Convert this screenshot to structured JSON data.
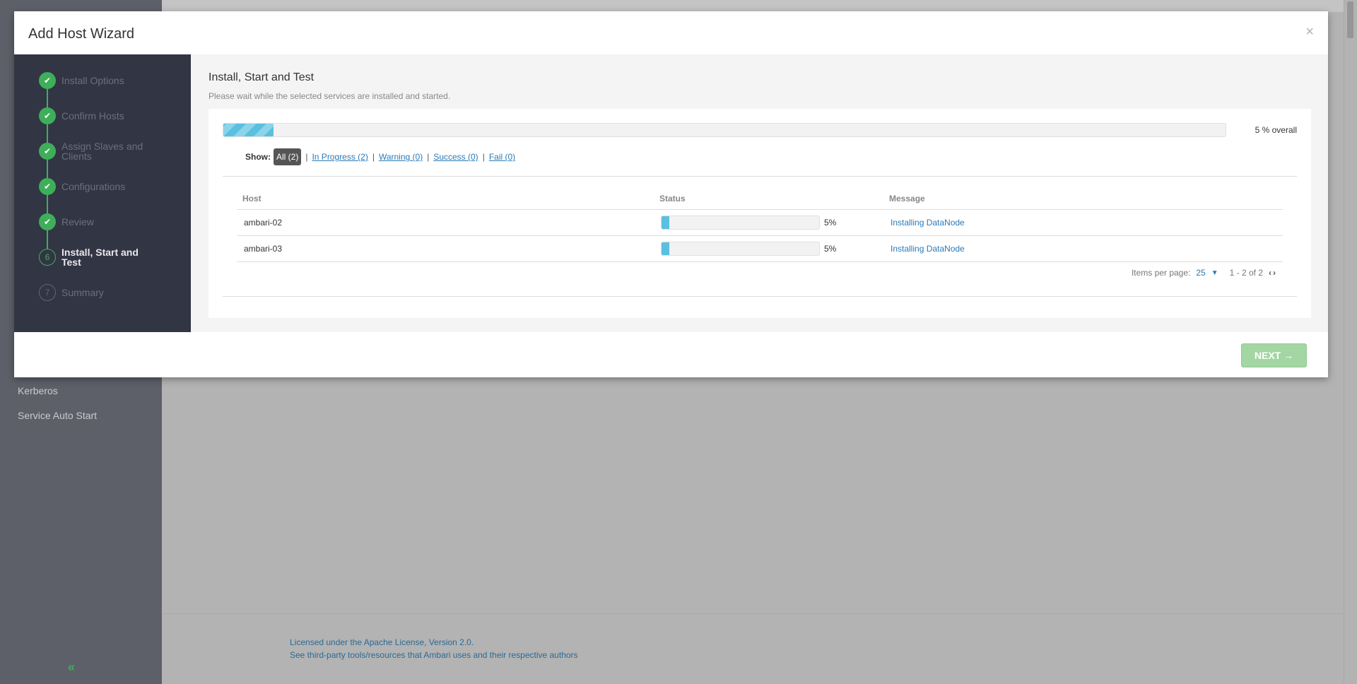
{
  "background": {
    "sidebar_links": [
      "Kerberos",
      "Service Auto Start"
    ],
    "footer": {
      "license": "Licensed under the Apache License, Version 2.0.",
      "third_party": "See third-party tools/resources that Ambari uses and their respective authors"
    }
  },
  "modal": {
    "title": "Add Host Wizard",
    "close": "×"
  },
  "steps": [
    {
      "num": "",
      "label": "Install Options",
      "state": "done"
    },
    {
      "num": "",
      "label": "Confirm Hosts",
      "state": "done"
    },
    {
      "num": "",
      "label": "Assign Slaves and Clients",
      "state": "done"
    },
    {
      "num": "",
      "label": "Configurations",
      "state": "done"
    },
    {
      "num": "",
      "label": "Review",
      "state": "done"
    },
    {
      "num": "6",
      "label": "Install, Start and Test",
      "state": "active"
    },
    {
      "num": "7",
      "label": "Summary",
      "state": "pending"
    }
  ],
  "content": {
    "title": "Install, Start and Test",
    "subtitle": "Please wait while the selected services are installed and started.",
    "overall_progress": 5,
    "overall_text": "5 % overall",
    "filters": {
      "show_label": "Show:",
      "all": "All (2)",
      "in_progress": "In Progress (2)",
      "warning": "Warning (0)",
      "success": "Success (0)",
      "fail": "Fail (0)"
    },
    "table": {
      "headers": [
        "Host",
        "Status",
        "Message"
      ],
      "rows": [
        {
          "host": "ambari-02",
          "progress": 5,
          "pct": "5%",
          "message": "Installing DataNode"
        },
        {
          "host": "ambari-03",
          "progress": 5,
          "pct": "5%",
          "message": "Installing DataNode"
        }
      ]
    },
    "pager": {
      "label": "Items per page:",
      "value": "25",
      "range": "1 - 2 of 2"
    }
  },
  "footer": {
    "next_label": "NEXT →"
  },
  "colors": {
    "accent_green": "#3fae5a",
    "progress_blue": "#5ac0e0",
    "nav_bg": "#323544"
  }
}
